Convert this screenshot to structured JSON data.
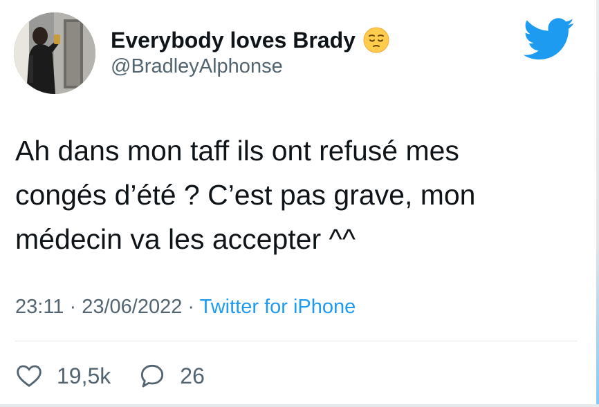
{
  "author": {
    "display_name": "Everybody loves Brady",
    "handle": "@BradleyAlphonse",
    "name_emoji": "pensive-face-emoji"
  },
  "tweet": {
    "lines": [
      "Ah dans mon taff ils ont refusé mes",
      "congés d’été ? C’est pas grave, mon",
      "médecin va les accepter ^^"
    ],
    "time": "23:11",
    "date": "23/06/2022",
    "separator": "·",
    "source": "Twitter for iPhone"
  },
  "stats": {
    "likes": "19,5k",
    "replies": "26"
  },
  "colors": {
    "brand": "#1d9bf0",
    "text": "#0f1419",
    "muted": "#536471"
  },
  "icons": {
    "logo": "twitter-bird-icon",
    "like": "heart-icon",
    "reply": "speech-bubble-icon"
  }
}
